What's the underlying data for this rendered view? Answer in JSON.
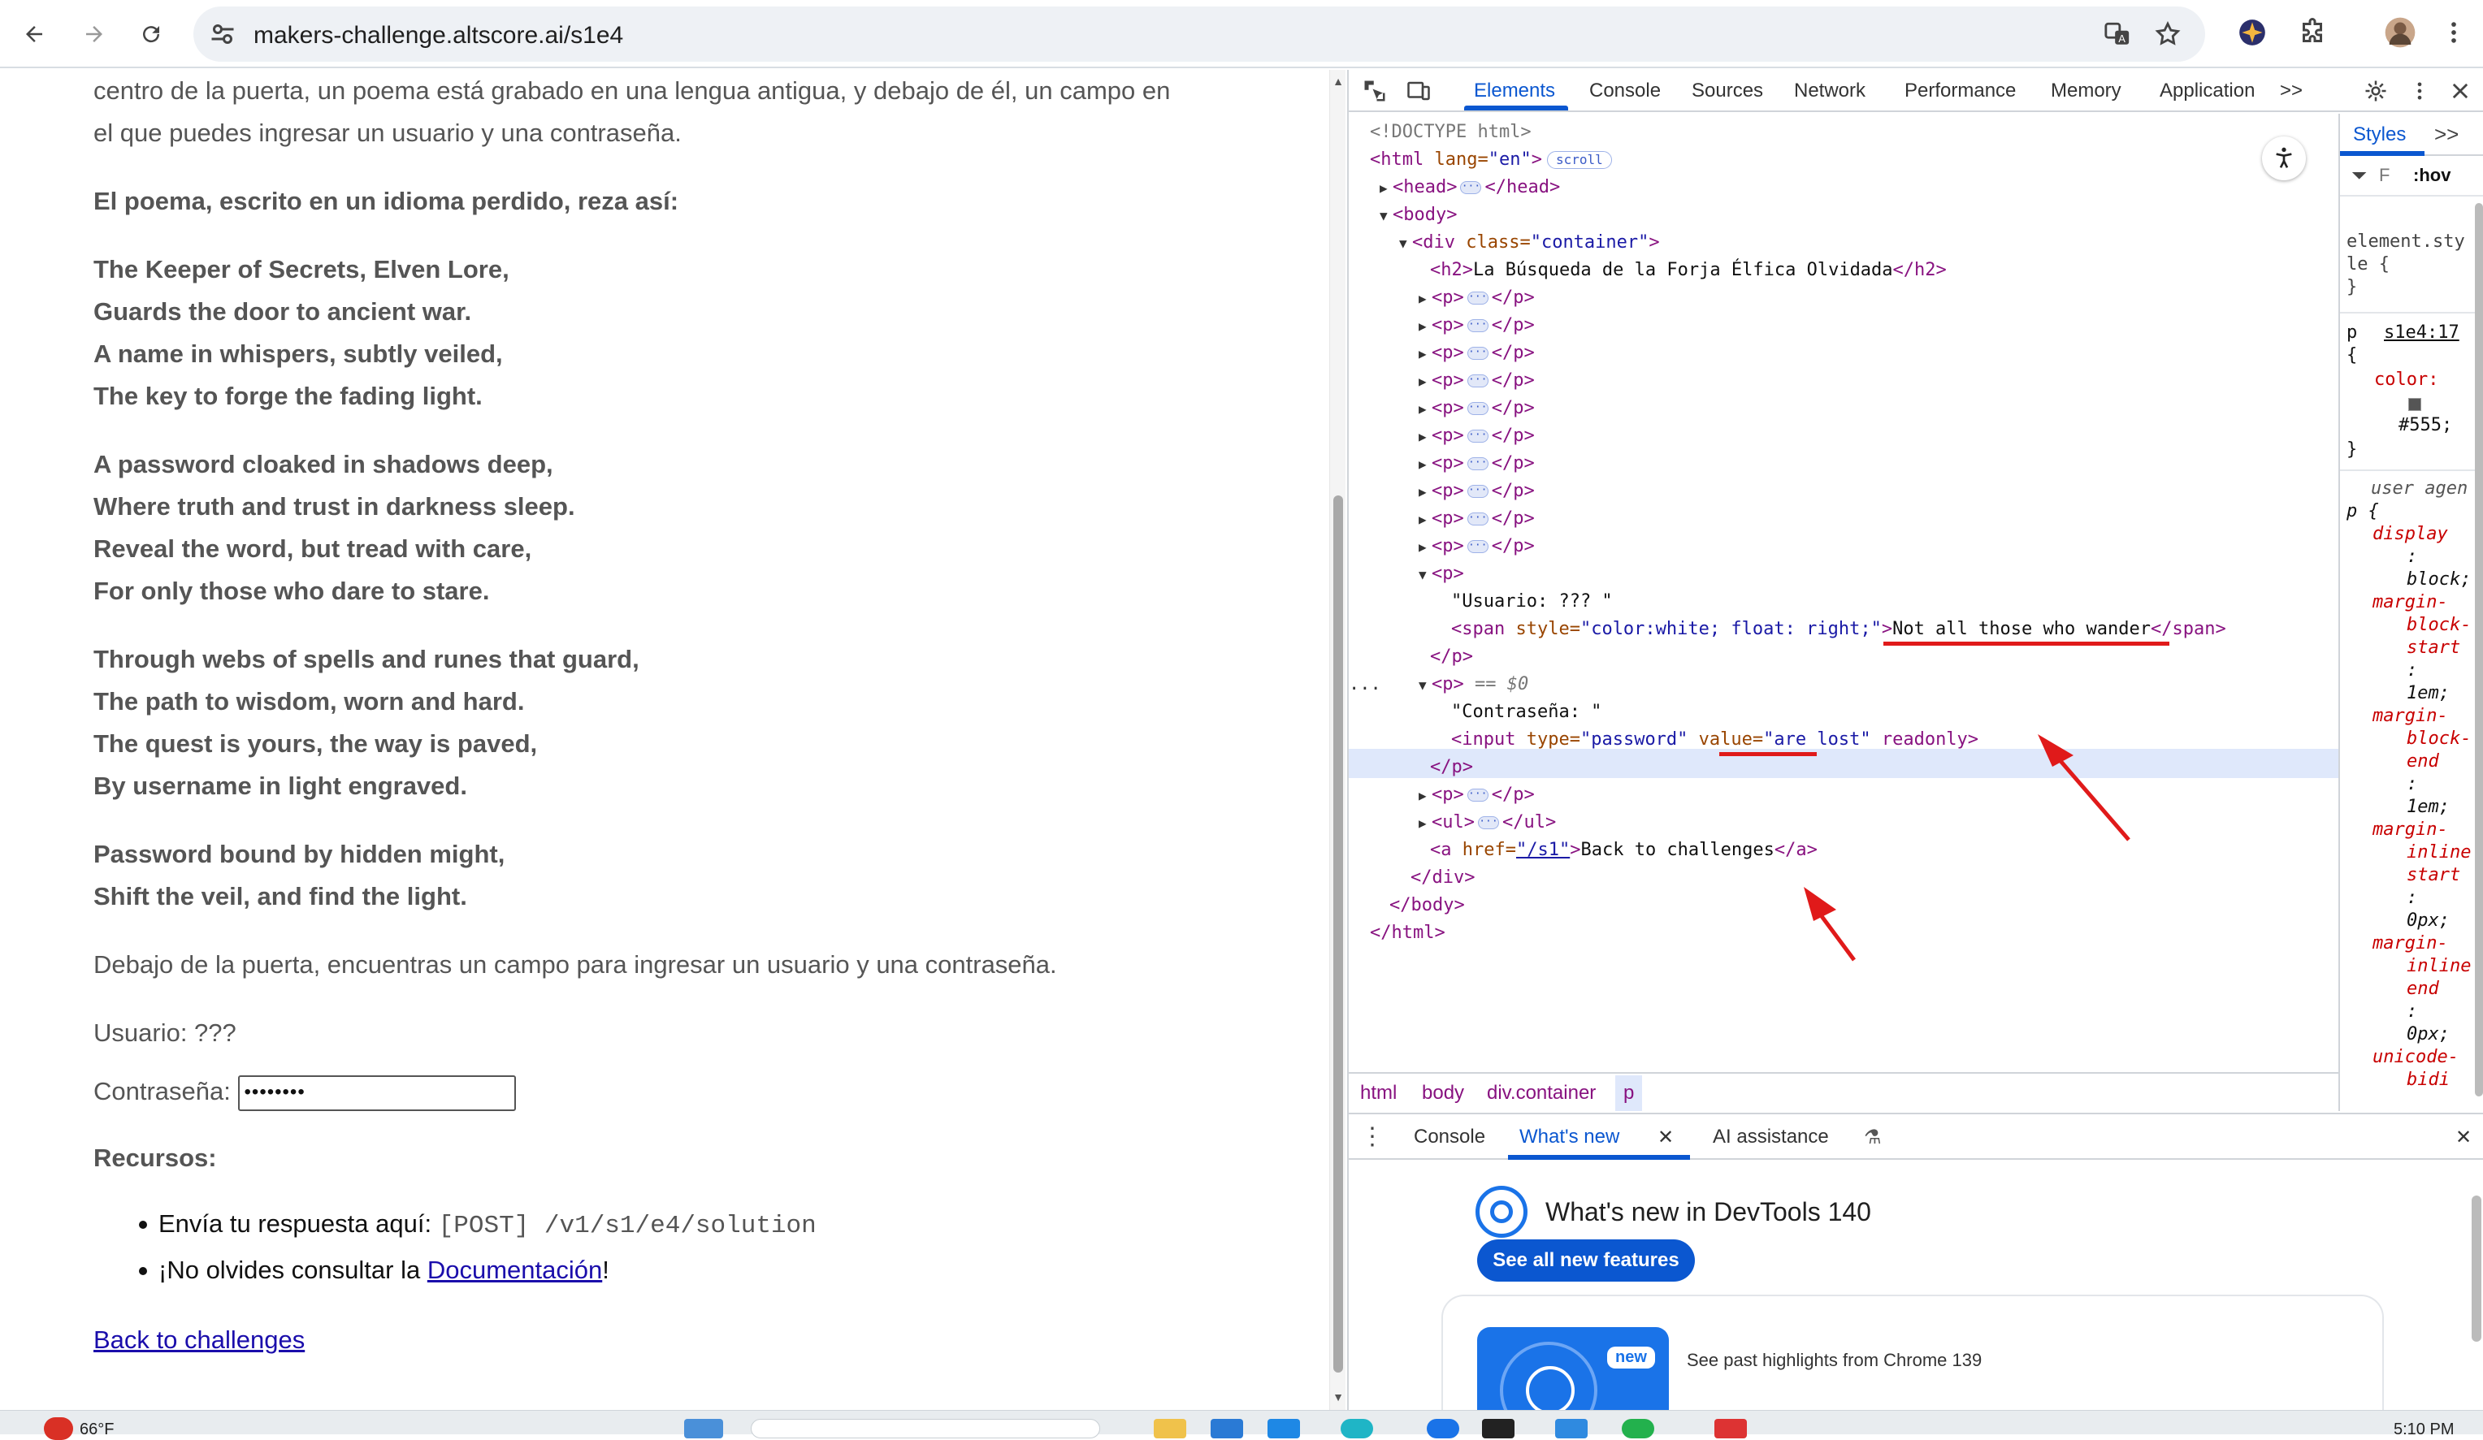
{
  "browser": {
    "url": "makers-challenge.altscore.ai/s1e4",
    "icons": [
      "back-icon",
      "forward-icon",
      "reload-icon",
      "site-settings-icon",
      "translate-icon",
      "bookmark-star-icon",
      "extension-icon",
      "puzzle-icon",
      "avatar",
      "menu-icon"
    ]
  },
  "page": {
    "intro_1": "centro de la puerta, un poema está grabado en una lengua antigua, y debajo de él, un campo en",
    "intro_2": "el que puedes ingresar un usuario y una contraseña.",
    "poem_heading": "El poema, escrito en un idioma perdido, reza así:",
    "poem": [
      "The Keeper of Secrets, Elven Lore,",
      "Guards the door to ancient war.",
      "A name in whispers, subtly veiled,",
      "The key to forge the fading light.",
      "A password cloaked in shadows deep,",
      "Where truth and trust in darkness sleep.",
      "Reveal the word, but tread with care,",
      "For only those who dare to stare.",
      "Through webs of spells and runes that guard,",
      "The path to wisdom, worn and hard.",
      "The quest is yours, the way is paved,",
      "By username in light engraved.",
      "Password bound by hidden might,",
      "Shift the veil, and find the light."
    ],
    "below_door": "Debajo de la puerta, encuentras un campo para ingresar un usuario y una contraseña.",
    "usuario": "Usuario: ???",
    "contrasena_label": "Contraseña:",
    "password_mask": "••••••••",
    "recursos": "Recursos:",
    "resource_1_text": "Envía tu respuesta aquí: ",
    "resource_1_code": "[POST] /v1/s1/e4/solution",
    "resource_2_text": "¡No olvides consultar la ",
    "resource_2_link": "Documentación",
    "resource_2_end": "!",
    "back_link": "Back to challenges"
  },
  "devtools": {
    "tabs": [
      "Elements",
      "Console",
      "Sources",
      "Network",
      "Performance",
      "Memory",
      "Application"
    ],
    "more_tabs": ">>",
    "dom": {
      "doctype": "<!DOCTYPE html>",
      "html_open": "<html",
      "html_lang_attr": " lang=",
      "html_lang_val": "\"en\"",
      "scroll_badge": "scroll",
      "head_open": "<head>",
      "head_close": "</head>",
      "body_open": "<body>",
      "div_open": "<div",
      "div_class_attr": " class=",
      "div_class_val": "\"container\"",
      "h2_open": "<h2>",
      "h2_text": "La Búsqueda de la Forja Élfica Olvidada",
      "h2_close": "</h2>",
      "p_open": "<p>",
      "p_close": "</p>",
      "usuario_text": "\"Usuario: ??? \"",
      "span_open": "<span",
      "span_style_attr": " style=",
      "span_style_val": "\"color:white; float: right;\"",
      "span_text": "Not all those who wander",
      "span_close": "</span>",
      "p_eq": " == $0",
      "contrasena_text": "\"Contraseña: \"",
      "input_open": "<input",
      "input_type_attr": " type=",
      "input_type_val": "\"password\"",
      "input_value_attr": " value=",
      "input_value_val": "\"are lost\"",
      "input_readonly": " readonly>",
      "ul_open": "<ul>",
      "ul_close": "</ul>",
      "a_open": "<a",
      "a_href_attr": " href=",
      "a_href_val": "\"/s1\"",
      "a_text": "Back to challenges",
      "a_close": "</a>",
      "div_close": "</div>",
      "body_close": "</body>",
      "html_close": "</html>",
      "ellipsis": "..."
    },
    "breadcrumbs": [
      "html",
      "body",
      "div.container",
      "p"
    ],
    "styles": {
      "tab": "Styles",
      "filter_placeholder": "F",
      "hov": ":hov",
      "element_style_1": "element.sty",
      "element_style_2": "le {",
      "brace_close": "}",
      "p_selector": "p",
      "p_source": "s1e4:17",
      "p_open": "{",
      "color_prop": "color",
      "color_val": "#555;",
      "user_agent": "user agen",
      "ua_selector": "p {",
      "ua_props": [
        "display",
        ":",
        "block;",
        "margin-",
        "block-",
        "start",
        ":",
        "1em;",
        "margin-",
        "block-",
        "end",
        ":",
        "1em;",
        "margin-",
        "inline",
        "start",
        ":",
        "0px;",
        "margin-",
        "inline",
        "end",
        ":",
        "0px;",
        "unicode-",
        "bidi"
      ]
    },
    "drawer": {
      "tabs": [
        "Console",
        "What's new",
        "AI assistance"
      ],
      "title": "What's new in DevTools 140",
      "button": "See all new features",
      "badge": "new",
      "highlight": "See past highlights from Chrome 139"
    }
  },
  "taskbar": {
    "weather": "66°F",
    "time": "5:10 PM"
  }
}
